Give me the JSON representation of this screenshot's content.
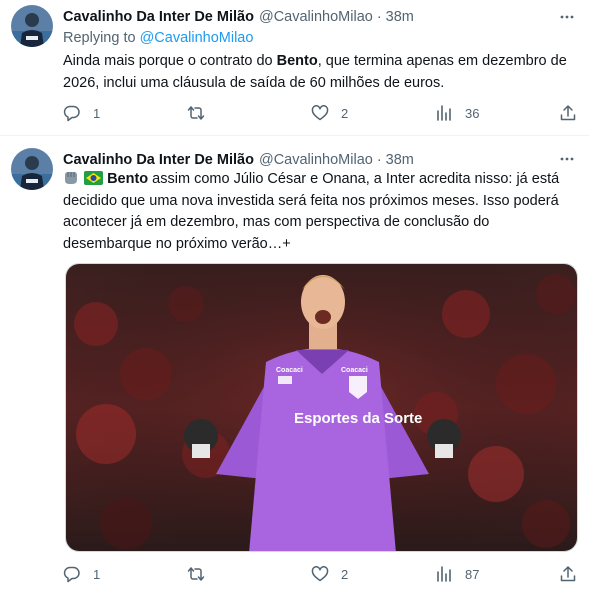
{
  "tweets": [
    {
      "author_name": "Cavalinho Da Inter De Milão",
      "author_handle": "@CavalinhoMilao",
      "separator": "·",
      "time": "38m",
      "replying_to_label": "Replying to",
      "replying_to_handle": "@CavalinhoMilao",
      "text_1": "Ainda mais porque o contrato do ",
      "text_bold": "Bento",
      "text_2": ", que termina apenas em dezembro de 2026, inclui uma cláusula de saída de 60 milhões de euros.",
      "counts": {
        "replies": "1",
        "retweets": "",
        "likes": "2",
        "views": "36"
      }
    },
    {
      "author_name": "Cavalinho Da Inter De Milão",
      "author_handle": "@CavalinhoMilao",
      "separator": "·",
      "time": "38m",
      "text_bold": "Bento",
      "text_2": " assim como Júlio César e Onana, a Inter acredita nisso: já está decidido que uma nova investida será feita nos próximos meses. Isso poderá acontecer já em dezembro, mas com perspectiva de conclusão do desembarque no próximo verão…+",
      "media_texts": {
        "sponsor": "Esportes da Sorte",
        "brand_chest": "Coacaci",
        "brand_sleeve": "Coacaci"
      },
      "counts": {
        "replies": "1",
        "retweets": "",
        "likes": "2",
        "views": "87"
      }
    }
  ],
  "icons": {
    "avatar": "avatar-image",
    "more": "more-horizontal-icon",
    "reply": "reply-icon",
    "retweet": "retweet-icon",
    "like": "heart-icon",
    "views": "analytics-icon",
    "share": "share-icon",
    "emoji_1": "fist-emoji",
    "emoji_2": "brazil-flag-emoji"
  },
  "colors": {
    "text": "#0f1419",
    "secondary": "#536471",
    "link": "#1d9bf0",
    "border": "#eff3f4",
    "jersey": "#9b59d6"
  }
}
